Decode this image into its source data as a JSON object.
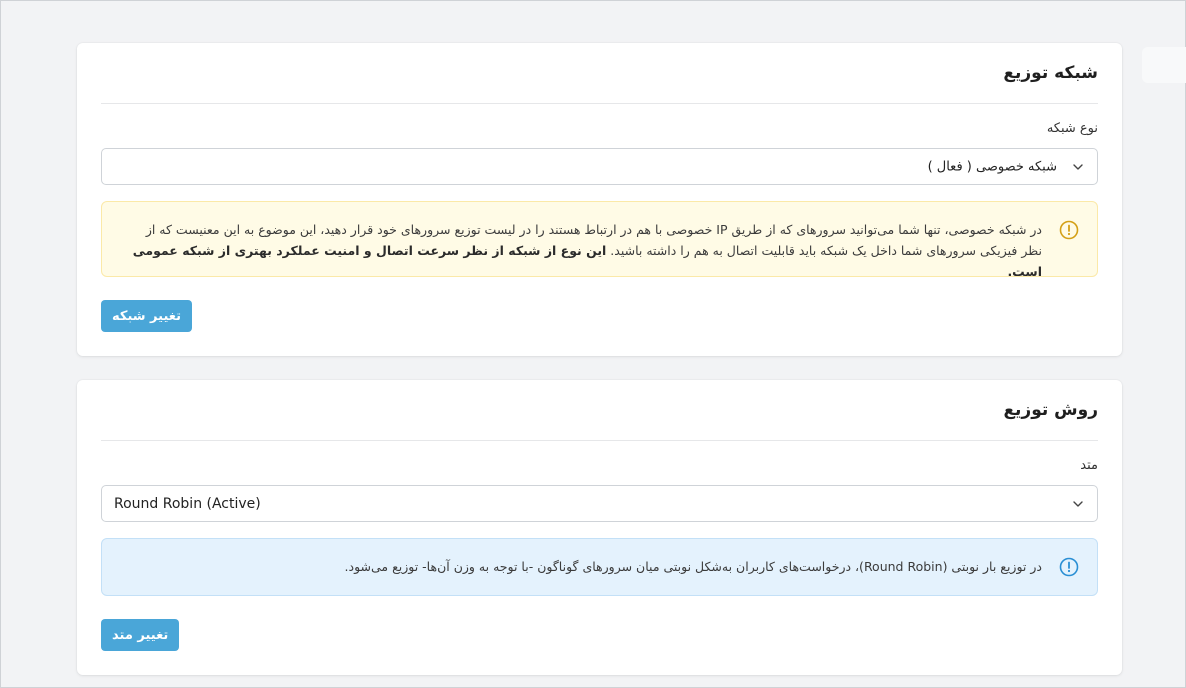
{
  "network_section": {
    "title": "شبکه توزیع",
    "field_label": "نوع شبکه",
    "selected_value": "شبکه خصوصی ( فعال )",
    "alert": {
      "text_normal": "در شبکه خصوصی، تنها شما می‌توانید سرورهای که از طریق IP خصوصی با هم در ارتباط هستند را در لیست توزیع سرورهای خود قرار دهید، این موضوع به این معنیست که از نظر فیزیکی سرورهای شما داخل یک شبکه باید قابلیت اتصال به هم را داشته باشید. ",
      "text_bold": "این نوع از شبکه از نظر سرعت اتصال و امنیت عملکرد بهتری از شبکه عمومی است.",
      "icon": "warning-circle-icon",
      "color": "#d4a017"
    },
    "button_label": "تغییر شبکه"
  },
  "method_section": {
    "title": "روش توزیع",
    "field_label": "متد",
    "selected_value": "Round Robin (Active)",
    "alert": {
      "text": "در توزیع بار نوبتی (Round Robin)، درخواست‌های کاربران به‌شکل نوبتی میان سرورهای گوناگون -با توجه به وزن آن‌ها- توزیع می‌شود.",
      "icon": "info-circle-icon",
      "color": "#2a8fd4"
    },
    "button_label": "تغییر متد"
  },
  "colors": {
    "accent": "#4aa6d8",
    "warning_bg": "#fffbe6",
    "info_bg": "#e4f2fd"
  }
}
